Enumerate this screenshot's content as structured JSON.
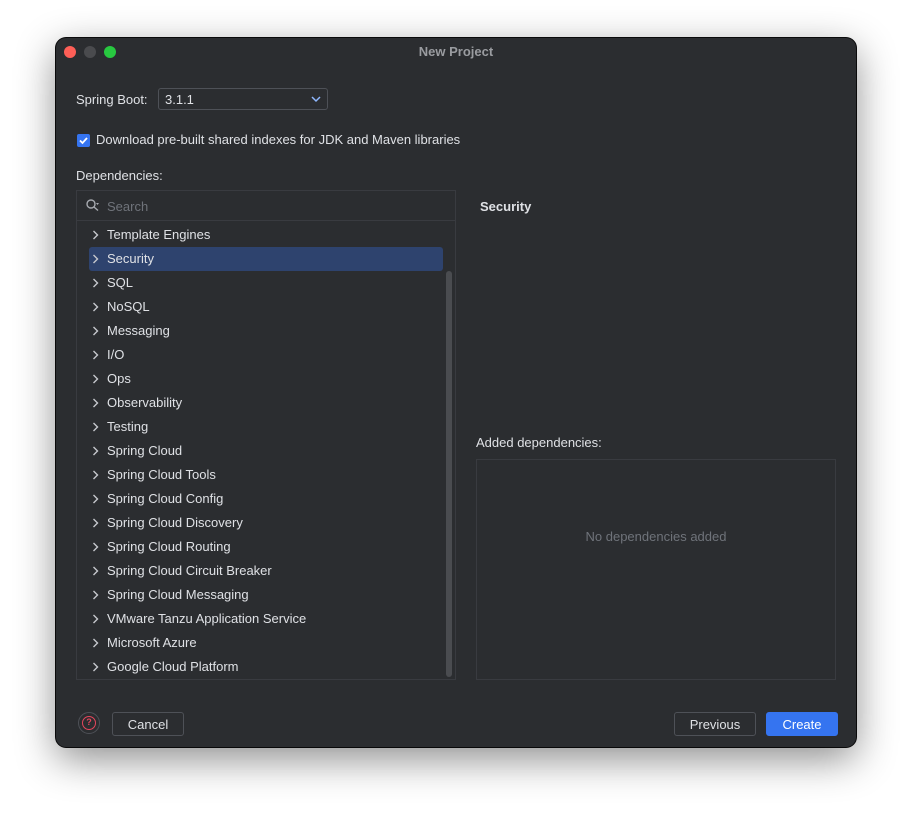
{
  "window": {
    "title": "New Project"
  },
  "spring_boot": {
    "label": "Spring Boot:",
    "version": "3.1.1"
  },
  "download_indexes": {
    "checked": true,
    "label": "Download pre-built shared indexes for JDK and Maven libraries"
  },
  "dependencies": {
    "label": "Dependencies:",
    "search_placeholder": "Search",
    "selected": "Security",
    "categories": [
      "Template Engines",
      "Security",
      "SQL",
      "NoSQL",
      "Messaging",
      "I/O",
      "Ops",
      "Observability",
      "Testing",
      "Spring Cloud",
      "Spring Cloud Tools",
      "Spring Cloud Config",
      "Spring Cloud Discovery",
      "Spring Cloud Routing",
      "Spring Cloud Circuit Breaker",
      "Spring Cloud Messaging",
      "VMware Tanzu Application Service",
      "Microsoft Azure",
      "Google Cloud Platform"
    ]
  },
  "detail": {
    "title": "Security"
  },
  "added": {
    "label": "Added dependencies:",
    "empty_text": "No dependencies added"
  },
  "footer": {
    "cancel": "Cancel",
    "previous": "Previous",
    "create": "Create",
    "help_icon": "help-icon"
  },
  "colors": {
    "accent": "#3574f0",
    "selection": "#2e436e",
    "close": "#fe5f57",
    "maximize": "#28c840",
    "help": "#e5465c"
  }
}
